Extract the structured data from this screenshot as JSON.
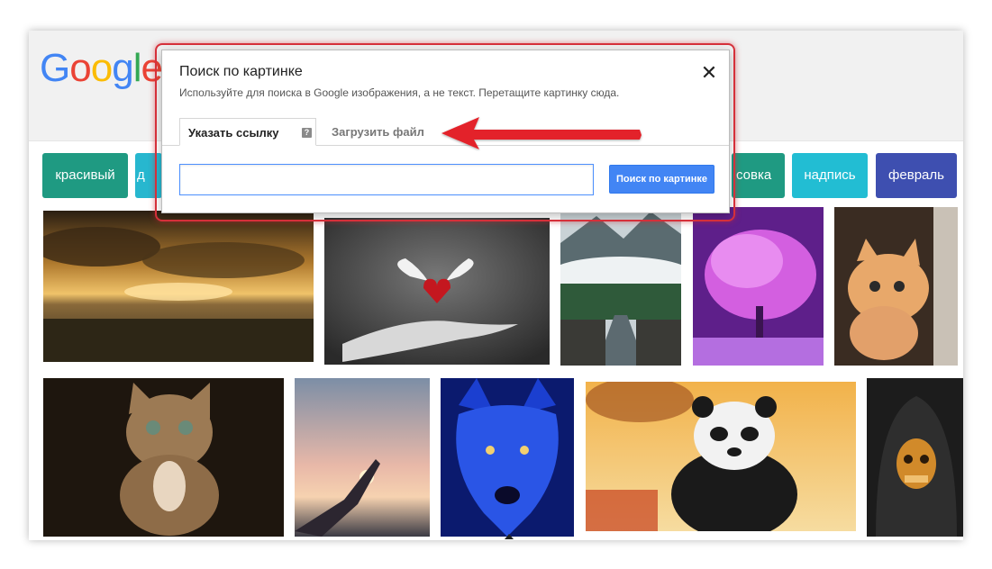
{
  "logo": {
    "letters": [
      {
        "ch": "G",
        "color": "#4285F4"
      },
      {
        "ch": "o",
        "color": "#EA4335"
      },
      {
        "ch": "o",
        "color": "#FBBC05"
      },
      {
        "ch": "g",
        "color": "#4285F4"
      },
      {
        "ch": "l",
        "color": "#34A853"
      },
      {
        "ch": "e",
        "color": "#EA4335"
      }
    ]
  },
  "chips": [
    {
      "label": "красивый",
      "color": "#1f9a82"
    },
    {
      "label": "д",
      "color": "#27b7cf"
    },
    {
      "label": "совка",
      "color": "#1f9a82"
    },
    {
      "label": "надпись",
      "color": "#22bdd3"
    },
    {
      "label": "февраль",
      "color": "#3e4fb0"
    }
  ],
  "dialog": {
    "title": "Поиск по картинке",
    "subtitle": "Используйте для поиска в Google изображения, а не текст. Перетащите картинку сюда.",
    "close": "✕",
    "tab_url": "Указать ссылку",
    "tab_help": "?",
    "tab_upload": "Загрузить файл",
    "input_value": "",
    "input_placeholder": "",
    "search_button": "Поиск по картинке"
  },
  "images": [
    "sunset-clouds-photo",
    "heart-with-wings-hand-photo",
    "misty-mountains-bridge-photo",
    "purple-tree-photo",
    "kitten-ginger-photo",
    "praying-kitten-photo",
    "sky-hand-sunset-photo",
    "blue-wolf-photo",
    "kung-fu-panda-photo",
    "hooded-skull-photo"
  ],
  "annotation": {
    "highlight_color": "#d5303a",
    "arrow_color": "#e3242b"
  }
}
